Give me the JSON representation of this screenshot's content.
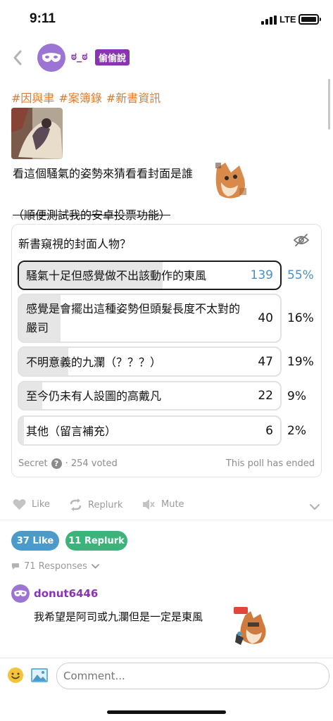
{
  "status": {
    "time": "9:11",
    "network": "LTE"
  },
  "header": {
    "nickname": "ಠ_ಠ",
    "badge": "偷偷說"
  },
  "post": {
    "tags": [
      "#因與聿",
      "#案簿錄",
      "#新書資訊"
    ],
    "line1": "看這個騷氣的姿勢來猜看看封面是誰",
    "line2": "（順便測試我的安卓投票功能）"
  },
  "poll": {
    "question": "新書窺視的封面人物？",
    "options": [
      {
        "label": "騷氣十足但感覺做不出該動作的東風",
        "count": "139",
        "percent": "55%",
        "share": 0.55,
        "selected": true
      },
      {
        "label": "感覺是會擺出這種姿勢但頭髮長度不太對的嚴司",
        "count": "40",
        "percent": "16%",
        "share": 0.16,
        "selected": false
      },
      {
        "label": "不明意義的九瀾（？？？）",
        "count": "47",
        "percent": "19%",
        "share": 0.19,
        "selected": false
      },
      {
        "label": "至今仍未有人設圖的高戴凡",
        "count": "22",
        "percent": "9%",
        "share": 0.09,
        "selected": false
      },
      {
        "label": "其他（留言補充）",
        "count": "6",
        "percent": "2%",
        "share": 0.02,
        "selected": false
      }
    ],
    "secret_label": "Secret",
    "voted": "· 254 voted",
    "ended": "This poll has ended"
  },
  "actions": {
    "like": "Like",
    "replurk": "Replurk",
    "mute": "Mute"
  },
  "stats": {
    "likes": "37 Like",
    "replurks": "11 Replurk"
  },
  "responses_label": "71 Responses",
  "response": {
    "name": "donut6446",
    "text": "我希望是阿司或九瀾但是一定是東風"
  },
  "composer": {
    "placeholder": "Comment..."
  },
  "colors": {
    "accent": "#8a34b4",
    "tag": "#e07a28",
    "like": "#4a9bc9",
    "replurk": "#3cb37a",
    "poll_blue": "#4a90c8"
  }
}
